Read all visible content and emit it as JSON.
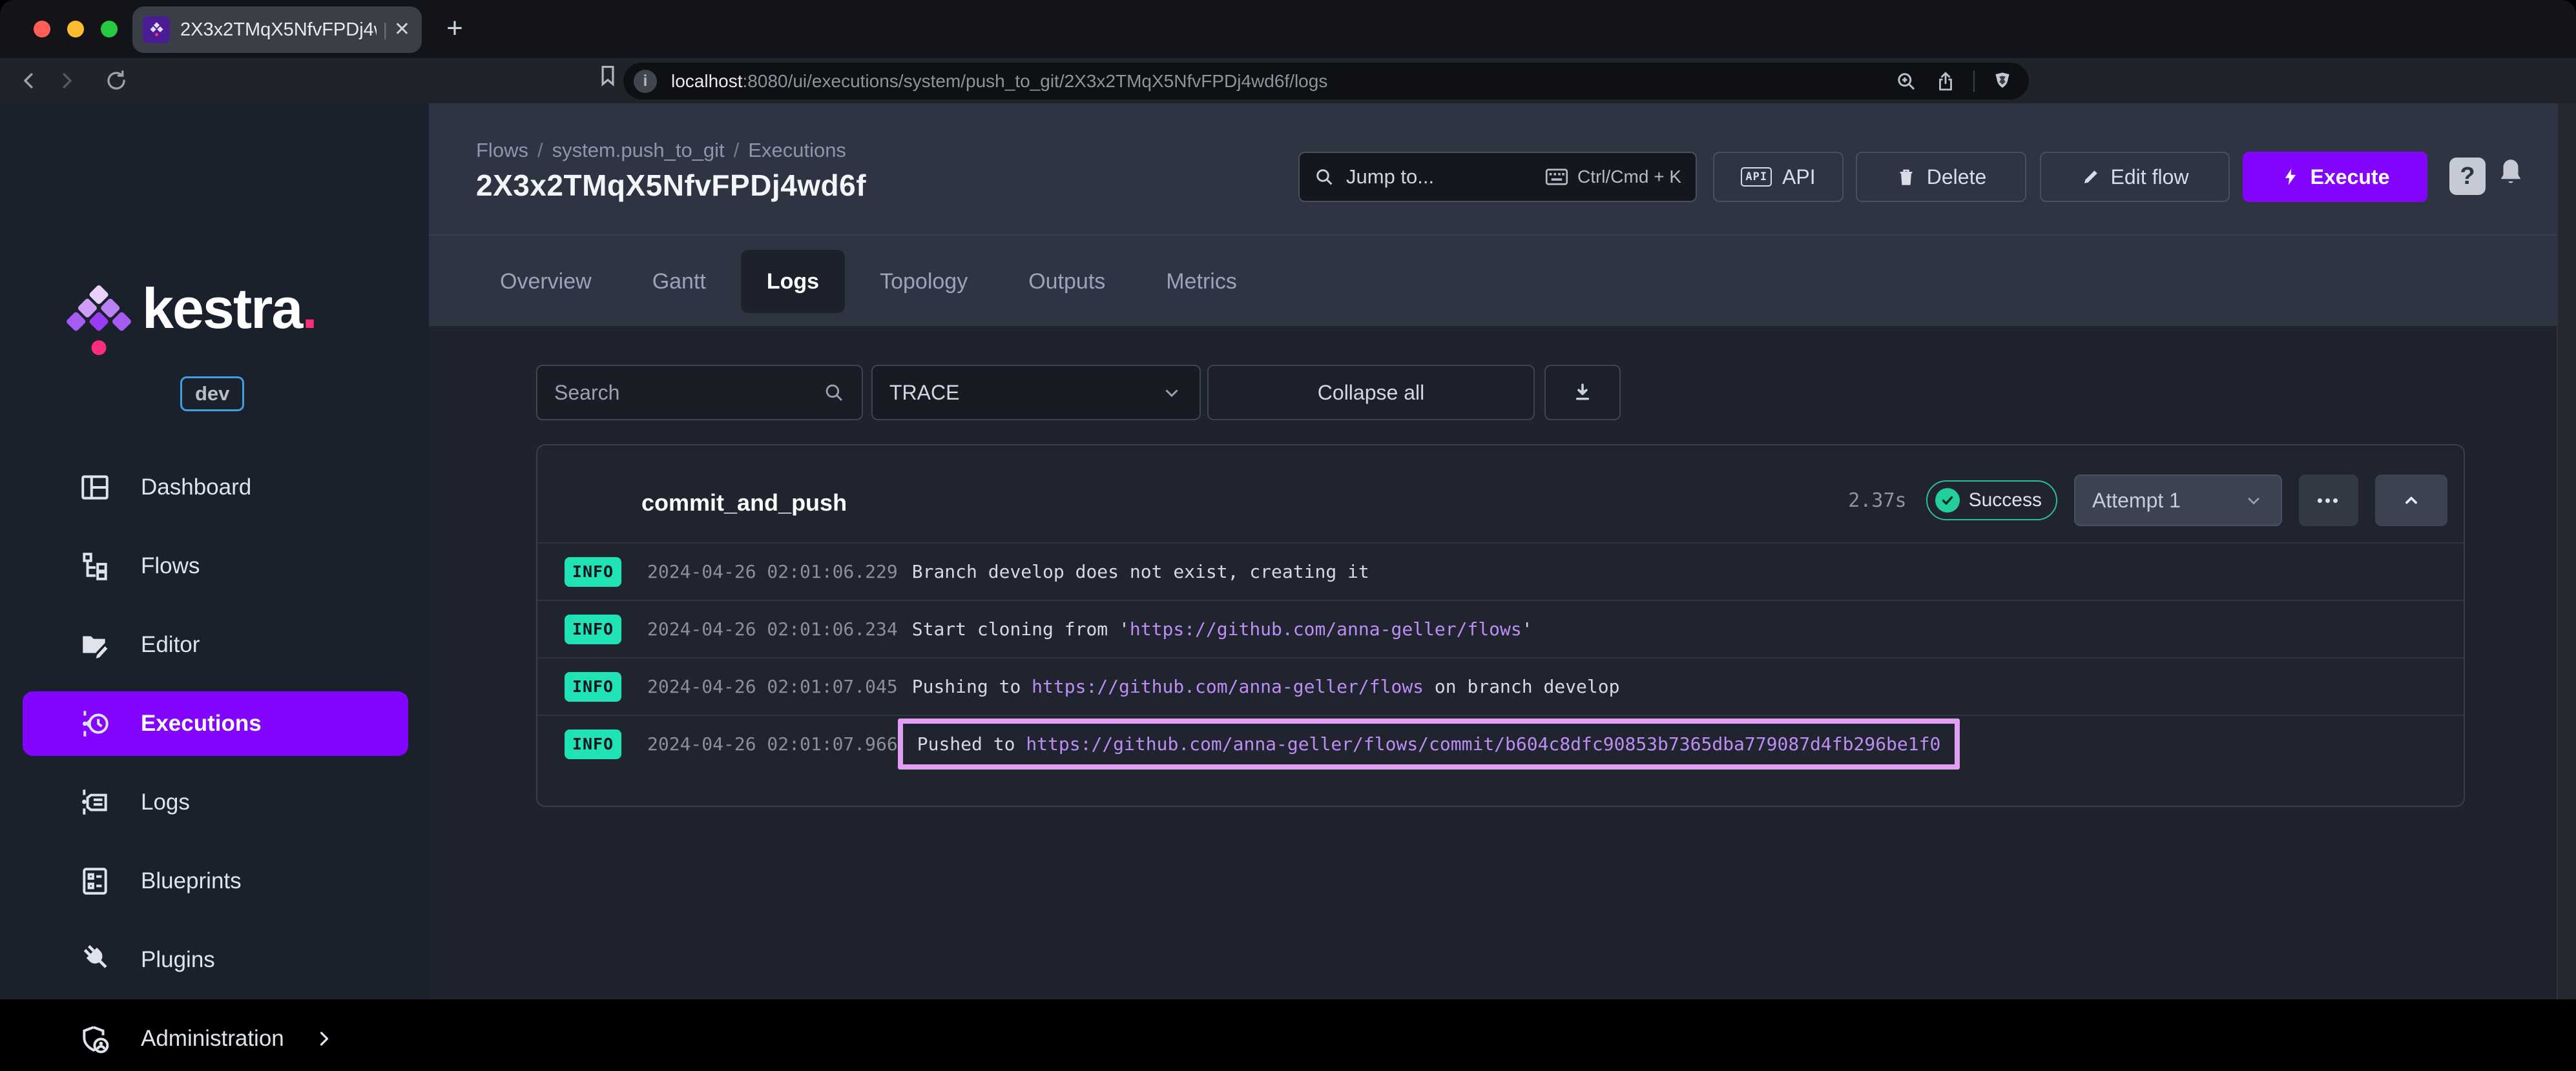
{
  "browser": {
    "tab_title": "2X3x2TMqX5NfvFPDj4wd6f",
    "url_host": "localhost",
    "url_path": ":8080/ui/executions/system/push_to_git/2X3x2TMqX5NfvFPDj4wd6f/logs"
  },
  "sidebar": {
    "logo_text": "kestra",
    "logo_dot": ".",
    "env_badge": "dev",
    "items": [
      {
        "label": "Dashboard",
        "icon": "dashboard",
        "active": false
      },
      {
        "label": "Flows",
        "icon": "flows",
        "active": false
      },
      {
        "label": "Editor",
        "icon": "editor",
        "active": false
      },
      {
        "label": "Executions",
        "icon": "executions",
        "active": true
      },
      {
        "label": "Logs",
        "icon": "logs",
        "active": false
      },
      {
        "label": "Blueprints",
        "icon": "blueprints",
        "active": false
      },
      {
        "label": "Plugins",
        "icon": "plugins",
        "active": false
      },
      {
        "label": "Administration",
        "icon": "administration",
        "active": false,
        "chevron": true
      }
    ]
  },
  "header": {
    "breadcrumb": [
      "Flows",
      "system.push_to_git",
      "Executions"
    ],
    "title": "2X3x2TMqX5NfvFPDj4wd6f",
    "jump_placeholder": "Jump to...",
    "jump_shortcut": "Ctrl/Cmd + K",
    "api_label": "API",
    "delete_label": "Delete",
    "edit_flow_label": "Edit flow",
    "execute_label": "Execute",
    "help_glyph": "?"
  },
  "tabs": [
    {
      "label": "Overview",
      "active": false
    },
    {
      "label": "Gantt",
      "active": false
    },
    {
      "label": "Logs",
      "active": true
    },
    {
      "label": "Topology",
      "active": false
    },
    {
      "label": "Outputs",
      "active": false
    },
    {
      "label": "Metrics",
      "active": false
    }
  ],
  "filters": {
    "search_placeholder": "Search",
    "level_value": "TRACE",
    "collapse_all_label": "Collapse all"
  },
  "task": {
    "name": "commit_and_push",
    "duration": "2.37s",
    "status": "Success",
    "attempt": "Attempt 1",
    "more_glyph": "•••"
  },
  "logs": [
    {
      "level": "INFO",
      "timestamp": "2024-04-26 02:01:06.229",
      "highlighted": false,
      "parts": [
        {
          "t": "Branch develop does not exist, creating it",
          "link": false
        }
      ]
    },
    {
      "level": "INFO",
      "timestamp": "2024-04-26 02:01:06.234",
      "highlighted": false,
      "parts": [
        {
          "t": "Start cloning from '",
          "link": false
        },
        {
          "t": "https://github.com/anna-geller/flows",
          "link": true
        },
        {
          "t": "'",
          "link": false
        }
      ]
    },
    {
      "level": "INFO",
      "timestamp": "2024-04-26 02:01:07.045",
      "highlighted": false,
      "parts": [
        {
          "t": "Pushing to ",
          "link": false
        },
        {
          "t": "https://github.com/anna-geller/flows",
          "link": true
        },
        {
          "t": " on branch develop",
          "link": false
        }
      ]
    },
    {
      "level": "INFO",
      "timestamp": "2024-04-26 02:01:07.966",
      "highlighted": true,
      "parts": [
        {
          "t": "Pushed to ",
          "link": false
        },
        {
          "t": "https://github.com/anna-geller/flows/commit/b604c8dfc90853b7365dba779087d4fb296be1f0",
          "link": true
        }
      ]
    }
  ],
  "colors": {
    "accent_purple": "#8405ff",
    "success_teal": "#21ce9c",
    "info_badge": "#1fe3b4",
    "link_purple": "#bd8df5",
    "highlight_border": "#e09ff1",
    "logo_pink": "#fa2e7c",
    "env_badge_border": "#3f9fd8"
  }
}
